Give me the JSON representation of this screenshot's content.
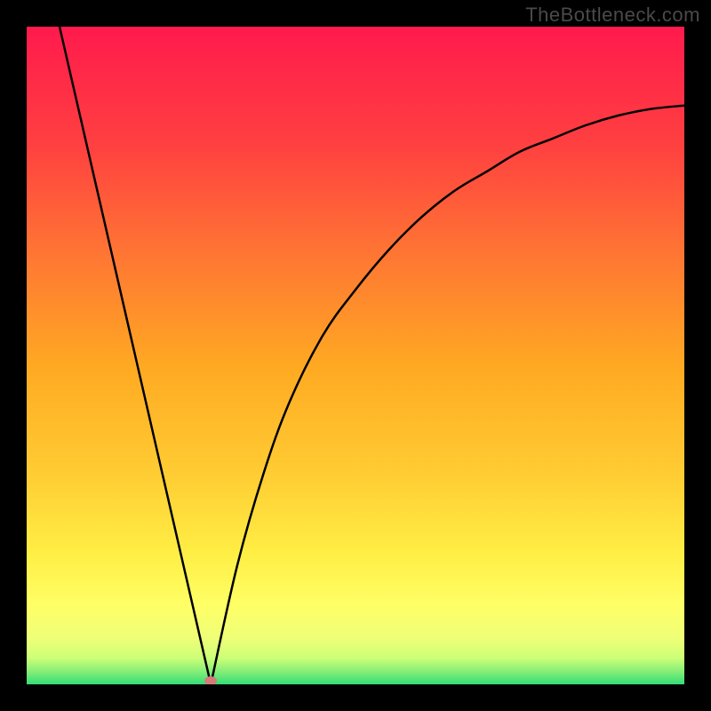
{
  "watermark": "TheBottleneck.com",
  "chart_data": {
    "type": "line",
    "title": "",
    "xlabel": "",
    "ylabel": "",
    "xlim": [
      0,
      100
    ],
    "ylim": [
      0,
      100
    ],
    "gradient_colors": {
      "top": "#ff1a4d",
      "upper_mid": "#ff6633",
      "mid": "#ffaa22",
      "lower_mid": "#ffdd33",
      "lower": "#ffff66",
      "near_bottom": "#ccff66",
      "bottom": "#33dd77"
    },
    "series": [
      {
        "name": "bottleneck-curve",
        "description": "V-shaped curve: steep linear descent on left, minimum near x=28, curved ascent on right approaching asymptote",
        "left_branch": {
          "type": "linear",
          "x": [
            5,
            28
          ],
          "y": [
            100,
            0
          ]
        },
        "right_branch": {
          "type": "curve",
          "x": [
            28,
            32,
            36,
            40,
            45,
            50,
            55,
            60,
            65,
            70,
            75,
            80,
            85,
            90,
            95,
            100
          ],
          "y": [
            0,
            18,
            32,
            43,
            53,
            60,
            66,
            71,
            75,
            78,
            81,
            83,
            85,
            86.5,
            87.5,
            88
          ]
        }
      }
    ],
    "marker": {
      "x": 28,
      "y": 0.5,
      "color": "#d77a7a"
    }
  }
}
